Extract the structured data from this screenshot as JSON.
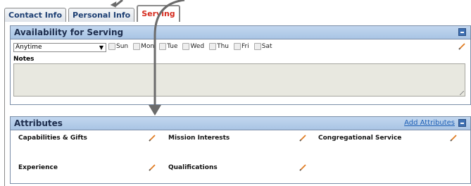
{
  "tabs": [
    {
      "label": "Contact Info",
      "active": false
    },
    {
      "label": "Personal Info",
      "active": false
    },
    {
      "label": "Serving",
      "active": true
    }
  ],
  "availability": {
    "title": "Availability for Serving",
    "select_value": "Anytime",
    "days": [
      "Sun",
      "Mon",
      "Tue",
      "Wed",
      "Thu",
      "Fri",
      "Sat"
    ],
    "notes_label": "Notes",
    "notes_value": ""
  },
  "attributes": {
    "title": "Attributes",
    "add_label": "Add Attributes",
    "items": [
      {
        "label": "Capabilities & Gifts"
      },
      {
        "label": "Mission Interests"
      },
      {
        "label": "Congregational Service"
      },
      {
        "label": "Experience"
      },
      {
        "label": "Qualifications"
      }
    ]
  },
  "colors": {
    "header_bg": "#b5cde9",
    "active_tab_text": "#d52b1e",
    "tab_text": "#1d3f73",
    "pencil": "#e07b20",
    "arrow": "#6b6b6b"
  },
  "icons": {
    "edit": "pencil-icon",
    "collapse": "collapse-icon"
  }
}
